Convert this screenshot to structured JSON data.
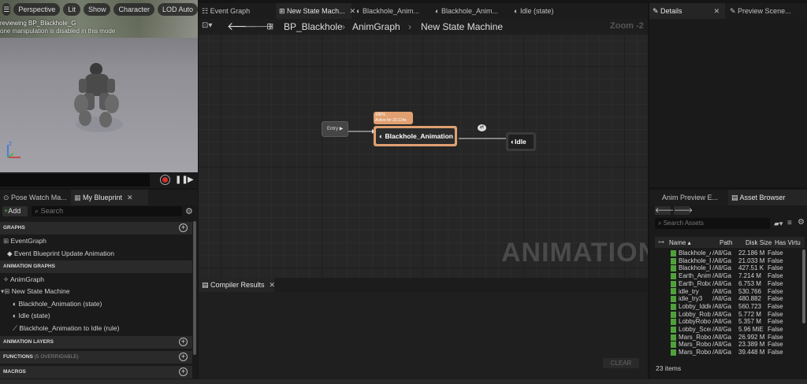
{
  "viewport": {
    "toolbar": [
      "Perspective",
      "Lit",
      "Show",
      "Character",
      "LOD Auto"
    ],
    "preview_line1": "reviewing BP_Blackhole_G",
    "preview_line2": "one manipulation is disabled in this mode"
  },
  "graph_tabs": [
    {
      "label": "Event Graph"
    },
    {
      "label": "New State Mach..."
    },
    {
      "label": "Blackhole_Anim..."
    },
    {
      "label": "Blackhole_Anim..."
    },
    {
      "label": "Idle (state)"
    }
  ],
  "breadcrumb": [
    "BP_Blackhole",
    "AnimGraph",
    "New State Machine"
  ],
  "zoom": "Zoom -2",
  "watermark": "ANIMATION",
  "nodes": {
    "entry": "Entry",
    "state1": "Blackhole_Animation",
    "state1_status1": "100%",
    "state1_status2": "Active for 23.114s",
    "state2": "Idle"
  },
  "compiler": {
    "tab": "Compiler Results",
    "clear": "CLEAR"
  },
  "right_tabs": {
    "details": "Details",
    "preview": "Preview Scene..."
  },
  "left_tabs": {
    "pose": "Pose Watch Ma...",
    "blueprint": "My Blueprint"
  },
  "blueprint": {
    "add": "Add",
    "search_placeholder": "Search",
    "sections": {
      "graphs": "GRAPHS",
      "anim_graphs": "ANIMATION GRAPHS",
      "anim_layers": "ANIMATION LAYERS",
      "functions": "FUNCTIONS",
      "functions_note": "(5 OVERRIDABLE)",
      "macros": "MACROS"
    },
    "items": {
      "event_graph": "EventGraph",
      "update_anim": "Event Blueprint Update Animation",
      "anim_graph": "AnimGraph",
      "state_machine": "New State Machine",
      "state1": "Blackhole_Animation (state)",
      "state2": "Idle (state)",
      "rule": "Blackhole_Animation to Idle (rule)"
    }
  },
  "asset_tabs": {
    "preview": "Anim Preview E...",
    "browser": "Asset Browser"
  },
  "asset_browser": {
    "search_placeholder": "Search Assets",
    "columns": [
      "Name",
      "Path",
      "Disk Size",
      "Has Virtu"
    ],
    "rows": [
      [
        "Blackhole_A",
        "/All/Ga",
        "22.186 M",
        "False"
      ],
      [
        "Blackhole_R",
        "/All/Ga",
        "21.033 M",
        "False"
      ],
      [
        "Blackhole_R",
        "/All/Ga",
        "427.51 K",
        "False"
      ],
      [
        "Earth_Anima",
        "/All/Ga",
        "7.214 M",
        "False"
      ],
      [
        "Earth_Robot",
        "/All/Ga",
        "6.753 M",
        "False"
      ],
      [
        "idle_try",
        "/All/Ga",
        "530.766",
        "False"
      ],
      [
        "idle_try3",
        "/All/Ga",
        "480.882",
        "False"
      ],
      [
        "Lobby_Iddle",
        "/All/Ga",
        "560.723",
        "False"
      ],
      [
        "Lobby_Robo",
        "/All/Ga",
        "5.772 M",
        "False"
      ],
      [
        "LobbyRobot_",
        "/All/Ga",
        "5.357 M",
        "False"
      ],
      [
        "Lobby_Scen",
        "/All/Ga",
        "5.96 MiE",
        "False"
      ],
      [
        "Mars_Robot_",
        "/All/Ga",
        "26.992 M",
        "False"
      ],
      [
        "Mars_Robot_",
        "/All/Ga",
        "23.389 M",
        "False"
      ],
      [
        "Mars_Robot_",
        "/All/Ga",
        "39.448 M",
        "False"
      ]
    ],
    "count": "23 items"
  },
  "colors": {
    "accent_orange": "#e0a070",
    "asset_green": "#4fa23a",
    "record_red": "#d03030"
  }
}
